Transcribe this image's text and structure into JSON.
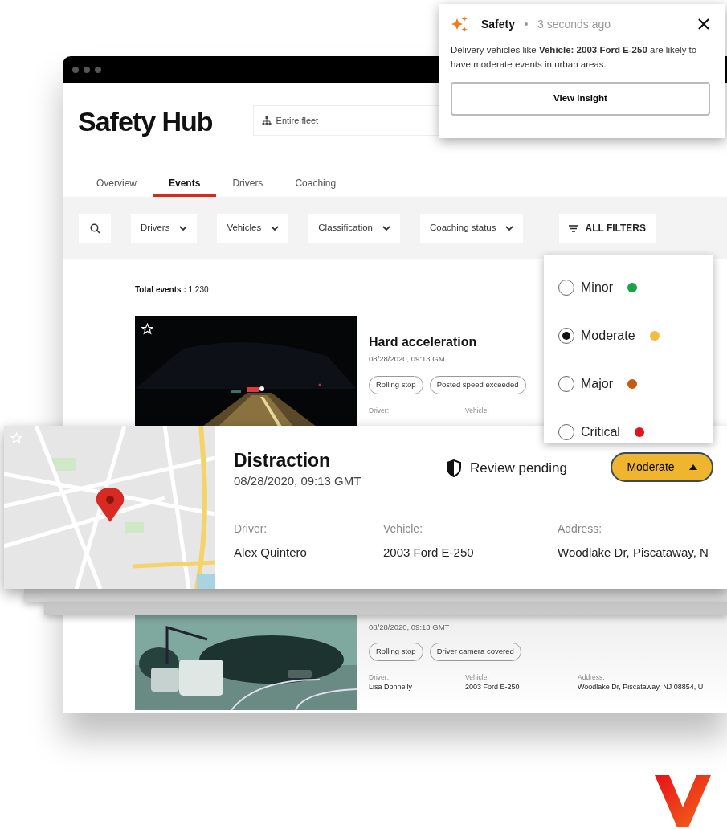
{
  "app": {
    "title": "Safety Hub",
    "fleet_selector": {
      "value": "Entire fleet"
    }
  },
  "tabs": [
    {
      "label": "Overview",
      "selected": false
    },
    {
      "label": "Events",
      "selected": true
    },
    {
      "label": "Drivers",
      "selected": false
    },
    {
      "label": "Coaching",
      "selected": false
    }
  ],
  "filters": [
    {
      "label": "Drivers"
    },
    {
      "label": "Vehicles"
    },
    {
      "label": "Classification"
    },
    {
      "label": "Coaching status"
    }
  ],
  "all_filters": {
    "label": "ALL FILTERS"
  },
  "total_events": {
    "label": "Total events :",
    "value": "1,230"
  },
  "events": [
    {
      "title": "Hard acceleration",
      "date": "08/28/2020, 09:13 GMT",
      "tags": [
        "Rolling stop",
        "Posted speed exceeded"
      ],
      "fields": [
        {
          "label": "Driver:"
        },
        {
          "label": "Vehicle:"
        }
      ]
    },
    {
      "date": "08/28/2020, 09:13 GMT",
      "tags": [
        "Rolling stop",
        "Driver camera covered"
      ],
      "fields": [
        {
          "label": "Driver:",
          "value": "Lisa Donnelly"
        },
        {
          "label": "Vehicle:",
          "value": "2003 Ford E-250"
        },
        {
          "label": "Address:",
          "value": "Woodlake Dr, Piscataway, NJ 08854, U"
        }
      ]
    }
  ],
  "focused_event": {
    "title": "Distraction",
    "date": "08/28/2020, 09:13 GMT",
    "review_status": "Review pending",
    "severity": "Moderate",
    "severity_expanded": true,
    "fields": [
      {
        "label": "Driver:",
        "value": "Alex Quintero"
      },
      {
        "label": "Vehicle:",
        "value": "2003 Ford E-250"
      },
      {
        "label": "Address:",
        "value": "Woodlake Dr, Piscataway, N"
      }
    ]
  },
  "severity_menu": {
    "options": [
      {
        "label": "Minor",
        "selected": false,
        "color": "#1aa34a"
      },
      {
        "label": "Moderate",
        "selected": true,
        "color": "#f2bd3c"
      },
      {
        "label": "Major",
        "selected": false,
        "color": "#c45a12"
      },
      {
        "label": "Critical",
        "selected": false,
        "color": "#e8101a"
      }
    ]
  },
  "notification": {
    "source": "Safety",
    "time": "3 seconds ago",
    "message": "Delivery vehicles like **Vehicle: 2003 Ford E-250** are likely to have moderate events in urban areas.",
    "action": "View insight"
  }
}
